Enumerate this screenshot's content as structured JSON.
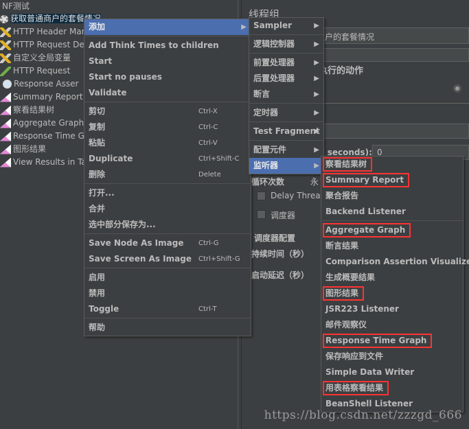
{
  "tree": {
    "items": [
      {
        "label": "NF测试",
        "icon": "none"
      },
      {
        "label": "获取普通商户的套餐情况",
        "icon": "gear-icon",
        "selected": true
      },
      {
        "label": "HTTP Header Man",
        "icon": "wrench-icon"
      },
      {
        "label": "HTTP Request Def",
        "icon": "wrench-icon"
      },
      {
        "label": "自定义全局变量",
        "icon": "wrench-icon"
      },
      {
        "label": "HTTP Request",
        "icon": "pen-icon"
      },
      {
        "label": "Response Asser",
        "icon": "magnifier-icon"
      },
      {
        "label": "Summary Report",
        "icon": "graph-icon"
      },
      {
        "label": "察看结果树",
        "icon": "graph-icon"
      },
      {
        "label": "Aggregate Graph",
        "icon": "graph-icon"
      },
      {
        "label": "Response Time G",
        "icon": "graph-icon"
      },
      {
        "label": "图形结果",
        "icon": "graph-icon"
      },
      {
        "label": "View Results in Ta",
        "icon": "graph-icon"
      }
    ]
  },
  "right": {
    "title": "线程组",
    "name_value": "户的套餐情况",
    "action_label": "执行的动作",
    "rampup_label": "n seconds):",
    "rampup_value": "0",
    "loop_label": "循环次数",
    "loop_forever": "永",
    "delay_label": "Delay Thread",
    "scheduler_label": "调度器",
    "scheduler_config": "调度器配置",
    "duration_label": "持续时间（秒）",
    "startup_delay_label": "启动延迟（秒）"
  },
  "menu1": [
    {
      "label": "添加",
      "arrow": true,
      "hl": true
    },
    {
      "sep": true
    },
    {
      "label": "Add Think Times to children"
    },
    {
      "label": "Start"
    },
    {
      "label": "Start no pauses"
    },
    {
      "label": "Validate"
    },
    {
      "sep": true
    },
    {
      "label": "剪切",
      "shortcut": "Ctrl-X"
    },
    {
      "label": "复制",
      "shortcut": "Ctrl-C"
    },
    {
      "label": "粘贴",
      "shortcut": "Ctrl-V"
    },
    {
      "label": "Duplicate",
      "shortcut": "Ctrl+Shift-C"
    },
    {
      "label": "删除",
      "shortcut": "Delete"
    },
    {
      "sep": true
    },
    {
      "label": "打开..."
    },
    {
      "label": "合并"
    },
    {
      "label": "选中部分保存为..."
    },
    {
      "sep": true
    },
    {
      "label": "Save Node As Image",
      "shortcut": "Ctrl-G"
    },
    {
      "label": "Save Screen As Image",
      "shortcut": "Ctrl+Shift-G"
    },
    {
      "sep": true
    },
    {
      "label": "启用"
    },
    {
      "label": "禁用"
    },
    {
      "label": "Toggle",
      "shortcut": "Ctrl-T"
    },
    {
      "sep": true
    },
    {
      "label": "帮助"
    }
  ],
  "menu2": [
    {
      "label": "Sampler",
      "arrow": true
    },
    {
      "sep": true
    },
    {
      "label": "逻辑控制器",
      "arrow": true
    },
    {
      "sep": true
    },
    {
      "label": "前置处理器",
      "arrow": true
    },
    {
      "label": "后置处理器",
      "arrow": true
    },
    {
      "label": "断言",
      "arrow": true
    },
    {
      "sep": true
    },
    {
      "label": "定时器",
      "arrow": true
    },
    {
      "sep": true
    },
    {
      "label": "Test Fragment",
      "arrow": true
    },
    {
      "sep": true
    },
    {
      "label": "配置元件",
      "arrow": true
    },
    {
      "label": "监听器",
      "arrow": true,
      "hl": true
    }
  ],
  "menu3": [
    {
      "label": "察看结果树",
      "boxed": true
    },
    {
      "label": "Summary Report",
      "boxed": true
    },
    {
      "label": "聚合报告"
    },
    {
      "label": "Backend Listener"
    },
    {
      "sep": true
    },
    {
      "label": "Aggregate Graph",
      "boxed": true
    },
    {
      "label": "断言结果"
    },
    {
      "label": "Comparison Assertion Visualizer"
    },
    {
      "label": "生成概要结果"
    },
    {
      "label": "图形结果",
      "boxed": true
    },
    {
      "label": "JSR223 Listener"
    },
    {
      "label": "邮件观察仪"
    },
    {
      "label": "Response Time Graph",
      "boxed": true
    },
    {
      "label": "保存响应到文件"
    },
    {
      "label": "Simple Data Writer"
    },
    {
      "label": "用表格察看结果",
      "boxed": true
    },
    {
      "label": "BeanShell Listener"
    }
  ],
  "watermark": "https://blog.csdn.net/zzzgd_666",
  "colors": {
    "highlight": "#4b6eaf",
    "annotation": "#ff3333",
    "background": "#3c3f41"
  }
}
